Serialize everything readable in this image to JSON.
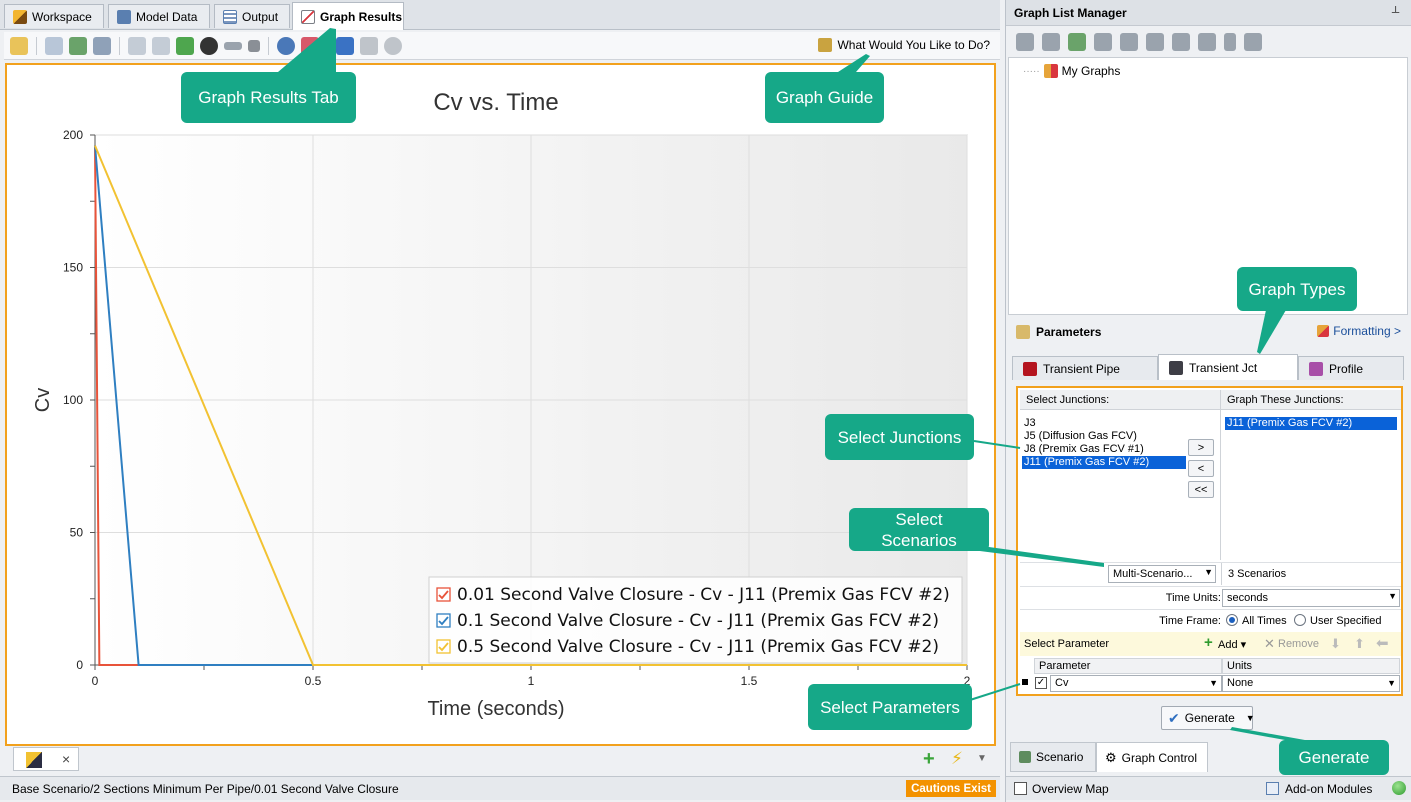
{
  "tabs": [
    {
      "label": "Workspace"
    },
    {
      "label": "Model Data"
    },
    {
      "label": "Output"
    },
    {
      "label": "Graph Results",
      "active": true
    }
  ],
  "toolbar": {
    "help_label": "What Would You Like to Do?"
  },
  "callouts": {
    "graph_results_tab": "Graph Results Tab",
    "graph_guide": "Graph Guide",
    "graph_types": "Graph Types",
    "select_junctions": "Select Junctions",
    "select_scenarios_1": "Select",
    "select_scenarios_2": "Scenarios",
    "select_parameters": "Select Parameters",
    "generate": "Generate"
  },
  "chart_data": {
    "type": "line",
    "title": "Cv vs. Time",
    "xlabel": "Time (seconds)",
    "ylabel": "Cv",
    "xlim": [
      0,
      2
    ],
    "ylim": [
      0,
      200
    ],
    "xticks": [
      "0",
      "0.5",
      "1",
      "1.5",
      "2"
    ],
    "yticks": [
      "0",
      "50",
      "100",
      "150",
      "200"
    ],
    "grid": true,
    "legend_position": "bottom-right",
    "series": [
      {
        "name": "0.01 Second Valve Closure - Cv - J11 (Premix Gas FCV #2)",
        "color": "#e8533a",
        "x": [
          0,
          0.01,
          2
        ],
        "y": [
          196,
          0,
          0
        ]
      },
      {
        "name": "0.1 Second Valve Closure - Cv - J11 (Premix Gas FCV #2)",
        "color": "#2f7fc1",
        "x": [
          0,
          0.1,
          2
        ],
        "y": [
          196,
          0,
          0
        ]
      },
      {
        "name": "0.5 Second Valve Closure - Cv - J11 (Premix Gas FCV #2)",
        "color": "#f2c232",
        "x": [
          0,
          0.5,
          2
        ],
        "y": [
          196,
          0,
          0
        ]
      }
    ]
  },
  "status": {
    "path": "Base Scenario/2 Sections Minimum Per Pipe/0.01 Second Valve Closure",
    "cautions": "Cautions Exist"
  },
  "graph_list": {
    "title": "Graph List Manager",
    "root": "My Graphs"
  },
  "parameters": {
    "title": "Parameters",
    "formatting": "Formatting >",
    "tabs": [
      "Transient Pipe",
      "Transient Jct",
      "Profile"
    ],
    "select_junctions_header": "Select Junctions:",
    "graph_these_header": "Graph These Junctions:",
    "junctions": [
      "J3",
      "J5 (Diffusion Gas FCV)",
      "J8 (Premix Gas FCV #1)",
      "J11 (Premix Gas FCV #2)"
    ],
    "selected_junctions": [
      "J11 (Premix Gas FCV #2)"
    ],
    "btn_add": ">",
    "btn_remove": "<",
    "btn_remove_all": "<<",
    "multi_scenario": "Multi-Scenario...",
    "scenario_count": "3 Scenarios",
    "time_units_label": "Time Units:",
    "time_units_value": "seconds",
    "time_frame_label": "Time Frame:",
    "time_frame_all": "All Times",
    "time_frame_user": "User Specified",
    "select_parameter_label": "Select Parameter",
    "add_label": "Add",
    "remove_label": "Remove",
    "col_parameter": "Parameter",
    "col_units": "Units",
    "row_parameter": "Cv",
    "row_units": "None",
    "generate": "Generate"
  },
  "right_bottom_tabs": [
    "Scenario",
    "Graph Control"
  ],
  "right_status": {
    "overview": "Overview Map",
    "addons": "Add-on Modules"
  }
}
